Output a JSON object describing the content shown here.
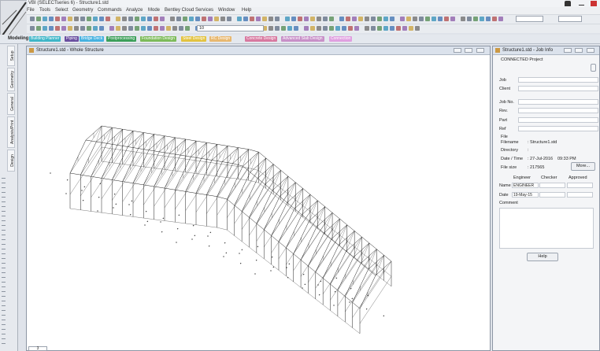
{
  "app": {
    "title": "VBI (SELECTseries 6) - Structure1.std"
  },
  "menubar": {
    "items": [
      "File",
      "Tools",
      "Select",
      "Geometry",
      "Commands",
      "Analyze",
      "Mode",
      "Bentley Cloud Services",
      "Window",
      "Help"
    ]
  },
  "toolbar": {
    "zoom_value": "10"
  },
  "tabs": {
    "modeling_label": "Modeling",
    "items": [
      {
        "label": "Building Planner",
        "color": "#3fb6c8"
      },
      {
        "label": "Piping",
        "color": "#6a4fa0"
      },
      {
        "label": "Bridge Deck",
        "color": "#46b2e0"
      },
      {
        "label": "Postprocessing",
        "color": "#3c9f5a"
      },
      {
        "label": "Foundation Design",
        "color": "#7dbb5a"
      },
      {
        "label": "Steel Design",
        "color": "#e3c340"
      },
      {
        "label": "RC Design",
        "color": "#e8b870"
      },
      {
        "label": "Concrete Design",
        "color": "#d879a0"
      },
      {
        "label": "Advanced Slab Design",
        "color": "#c890c8"
      },
      {
        "label": "Connection",
        "color": "#e0a0e0"
      }
    ]
  },
  "left_tabs": [
    "Setup",
    "Geometry",
    "General",
    "Analysis/Print",
    "Design"
  ],
  "viewport": {
    "title": "Structure1.std - Whole Structure"
  },
  "job_info": {
    "title": "Structure1.std - Job Info",
    "connected_project": "CONNECTED Project",
    "labels": {
      "job": "Job",
      "client": "Client",
      "job_no": "Job No.",
      "rev": "Rev.",
      "part": "Part",
      "ref": "Ref",
      "file": "File",
      "filename": "Filename",
      "directory": "Directory",
      "date_time": "Date / Time",
      "file_size": "File size",
      "name": "Name",
      "date": "Date",
      "comment": "Comment"
    },
    "filename_value": ": Structure1.std",
    "directory_value": ":",
    "date_value": ": 27-Jul-2016",
    "time_value": "09:33 PM",
    "file_size_value": ": 217565",
    "more_button": "More...",
    "columns": [
      "Engineer",
      "Checker",
      "Approved"
    ],
    "engineer_name": "ENGINEER",
    "engineer_date": "19-May-15",
    "help_button": "Help"
  },
  "bottom_tab": "3"
}
